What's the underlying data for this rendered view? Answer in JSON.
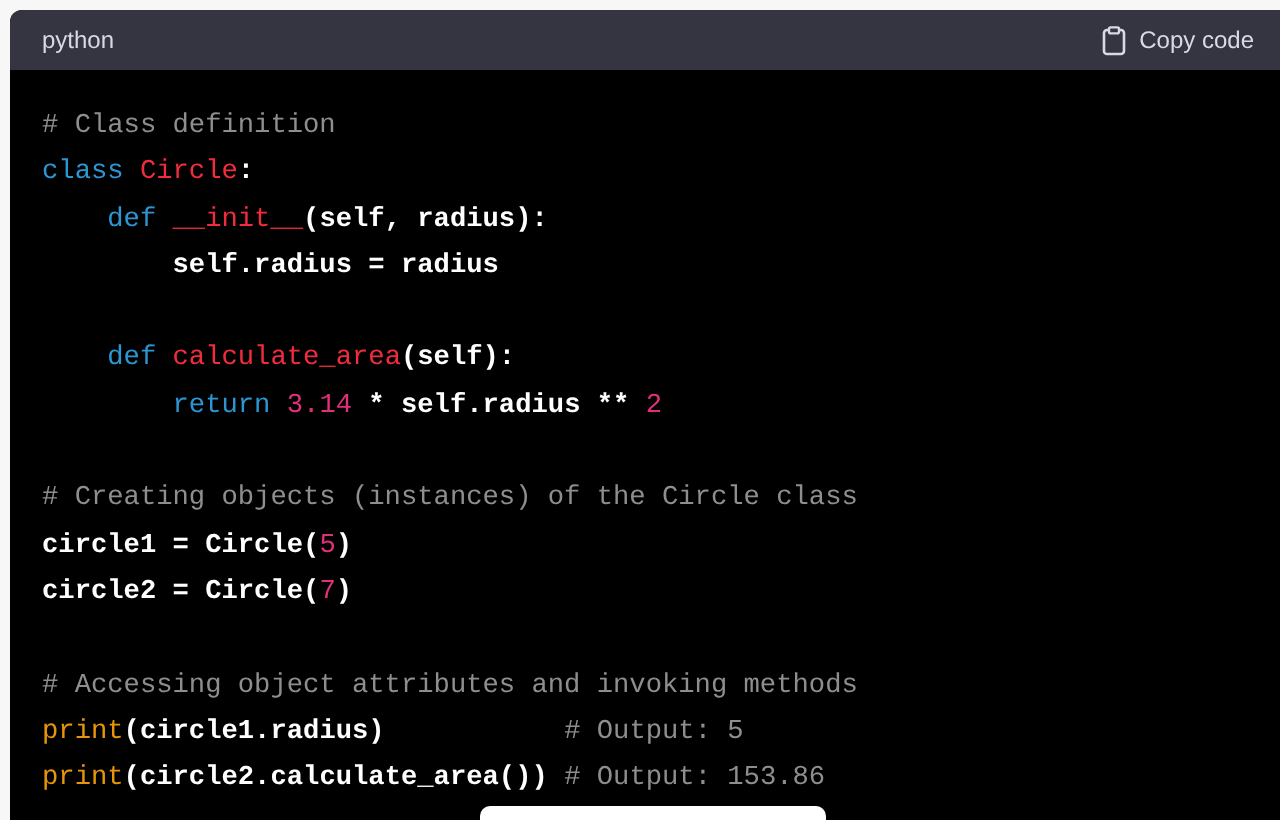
{
  "header": {
    "language": "python",
    "copy_button": {
      "label": "Copy code"
    }
  },
  "code_blocks": [
    {
      "lines": [
        {
          "tokens": [
            {
              "kind": "comment",
              "text": "# Class definition"
            }
          ]
        },
        {
          "tokens": [
            {
              "kind": "keyword",
              "text": "class "
            },
            {
              "kind": "name",
              "text": "Circle"
            },
            {
              "kind": "plain",
              "text": ":"
            }
          ]
        },
        {
          "tokens": [
            {
              "kind": "keyword",
              "text": "    def "
            },
            {
              "kind": "name",
              "text": "__init__"
            },
            {
              "kind": "plain",
              "text": "(self, radius):"
            }
          ]
        },
        {
          "tokens": [
            {
              "kind": "plain",
              "text": "        self.radius = radius"
            }
          ]
        }
      ]
    },
    {
      "lines": [
        {
          "tokens": [
            {
              "kind": "keyword",
              "text": "    def "
            },
            {
              "kind": "name",
              "text": "calculate_area"
            },
            {
              "kind": "plain",
              "text": "(self):"
            }
          ]
        },
        {
          "tokens": [
            {
              "kind": "keyword",
              "text": "        return "
            },
            {
              "kind": "number",
              "text": "3.14"
            },
            {
              "kind": "plain",
              "text": " * self.radius ** "
            },
            {
              "kind": "number",
              "text": "2"
            }
          ]
        }
      ]
    },
    {
      "lines": [
        {
          "tokens": [
            {
              "kind": "comment",
              "text": "# Creating objects (instances) of the Circle class"
            }
          ]
        },
        {
          "tokens": [
            {
              "kind": "plain",
              "text": "circle1 = Circle("
            },
            {
              "kind": "number",
              "text": "5"
            },
            {
              "kind": "plain",
              "text": ")"
            }
          ]
        },
        {
          "tokens": [
            {
              "kind": "plain",
              "text": "circle2 = Circle("
            },
            {
              "kind": "number",
              "text": "7"
            },
            {
              "kind": "plain",
              "text": ")"
            }
          ]
        }
      ]
    },
    {
      "lines": [
        {
          "tokens": [
            {
              "kind": "comment",
              "text": "# Accessing object attributes and invoking methods"
            }
          ]
        },
        {
          "tokens": [
            {
              "kind": "builtin",
              "text": "print"
            },
            {
              "kind": "plain",
              "text": "(circle1.radius)           "
            },
            {
              "kind": "comment",
              "text": "# Output: 5"
            }
          ]
        },
        {
          "tokens": [
            {
              "kind": "builtin",
              "text": "print"
            },
            {
              "kind": "plain",
              "text": "(circle2.calculate_area()) "
            },
            {
              "kind": "comment",
              "text": "# Output: 153.86"
            }
          ]
        }
      ]
    }
  ]
}
